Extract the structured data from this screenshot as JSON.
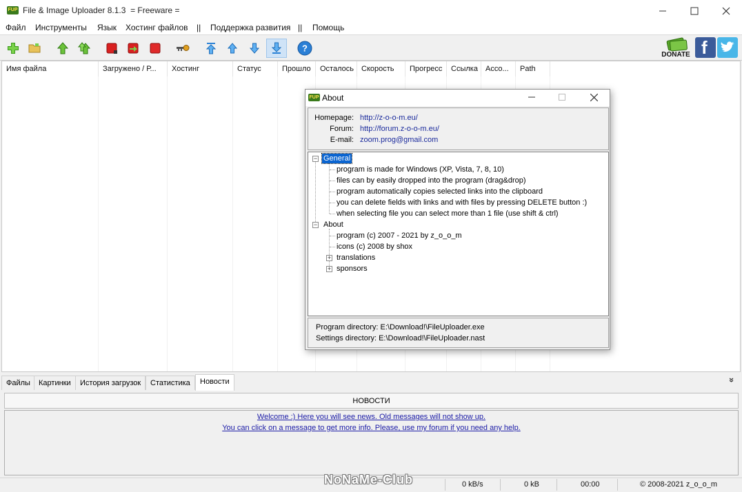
{
  "window": {
    "title": "File & Image Uploader 8.1.3  = Freeware =",
    "icon_label": "FUP"
  },
  "menu": [
    "Файл",
    "Инструменты",
    "Язык",
    "Хостинг файлов",
    "||",
    "Поддержка развития",
    "||",
    "Помощь"
  ],
  "toolbar": {
    "buttons": [
      "add-file-icon",
      "open-folder-icon",
      "upload-icon",
      "upload-all-icon",
      "stop-icon",
      "remove-icon",
      "delete-icon",
      "keys-icon",
      "move-top-icon",
      "move-up-icon",
      "move-down-icon",
      "move-bottom-icon",
      "help-icon"
    ],
    "donate_label": "DONATE",
    "facebook_label": "f"
  },
  "columns": [
    "Имя файла",
    "Загружено / Р...",
    "Хостинг",
    "Статус",
    "Прошло",
    "Осталось",
    "Скорость",
    "Прогресс",
    "Ссылка",
    "Acco...",
    "Path"
  ],
  "tabs": [
    "Файлы",
    "Картинки",
    "История загрузок",
    "Статистика",
    "Новости"
  ],
  "active_tab": "Новости",
  "news": {
    "header": "НОВОСТИ",
    "lines": [
      "Welcome :) Here you will see news. Old messages will not show up.",
      "You can click on a message to get more info. Please, use my forum if you need any help."
    ],
    "collapse_glyph": "»"
  },
  "statusbar": {
    "speed": "0 kB/s",
    "size": "0 kB",
    "time": "00:00",
    "copyright": "© 2008-2021 z_o_o_m",
    "watermark": "NoNaMe-Club"
  },
  "about": {
    "title": "About",
    "icon_label": "FUP",
    "homepage_label": "Homepage:",
    "homepage": "http://z-o-o-m.eu/",
    "forum_label": "Forum:",
    "forum": "http://forum.z-o-o-m.eu/",
    "email_label": "E-mail:",
    "email": "zoom.prog@gmail.com",
    "tree": {
      "general": "General",
      "general_items": [
        "program is made for Windows (XP, Vista, 7, 8, 10)",
        "files can by easily dropped into the program (drag&drop)",
        "program automatically copies selected links into the clipboard",
        "you can delete fields with links and with files by pressing DELETE button :)",
        "when selecting file you can select more than 1 file (use shift & ctrl)"
      ],
      "about": "About",
      "about_items": [
        "program (c) 2007 - 2021 by z_o_o_m",
        "icons (c) 2008 by shox"
      ],
      "about_collapsed": [
        "translations",
        "sponsors"
      ]
    },
    "program_dir": "Program directory: E:\\Download!\\FileUploader.exe",
    "settings_dir": "Settings directory: E:\\Download!\\FileUploader.nast"
  },
  "colors": {
    "link": "#1a2a9c",
    "selection": "#0a64d0",
    "news_link": "#1b1ba6"
  }
}
